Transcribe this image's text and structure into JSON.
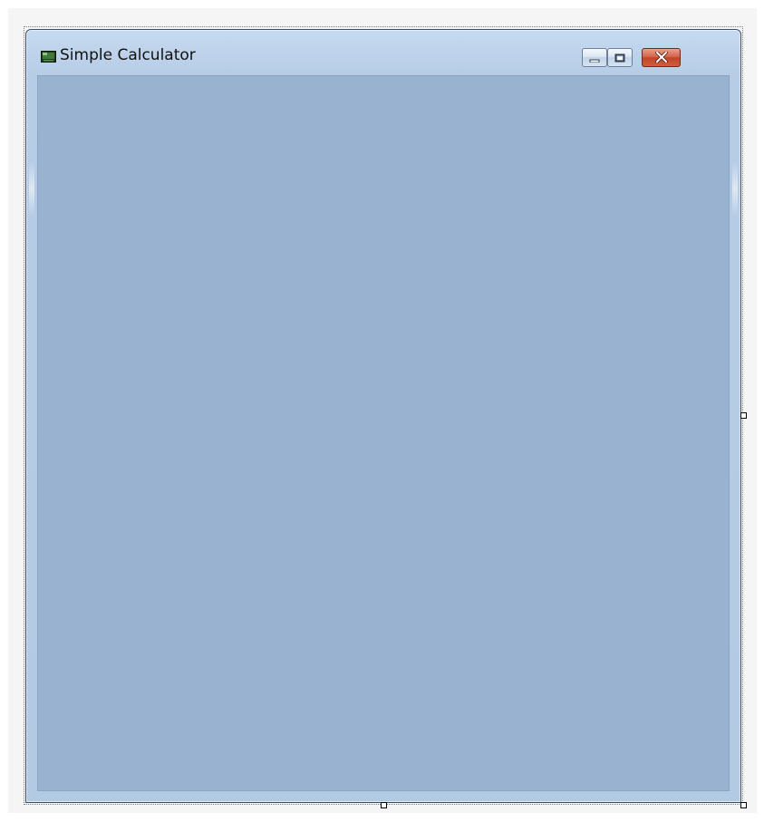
{
  "window": {
    "title": "Simple Calculator",
    "icon": "app-window-icon"
  },
  "caption_buttons": {
    "minimize_icon": "minimize-icon",
    "maximize_icon": "maximize-icon",
    "close_icon": "close-icon"
  },
  "colors": {
    "client_area": "#98b2d0",
    "frame": "#b7cde6",
    "close_button": "#c24429"
  },
  "designer": {
    "resize_handles": [
      "right",
      "bottom",
      "bottom-right"
    ]
  }
}
